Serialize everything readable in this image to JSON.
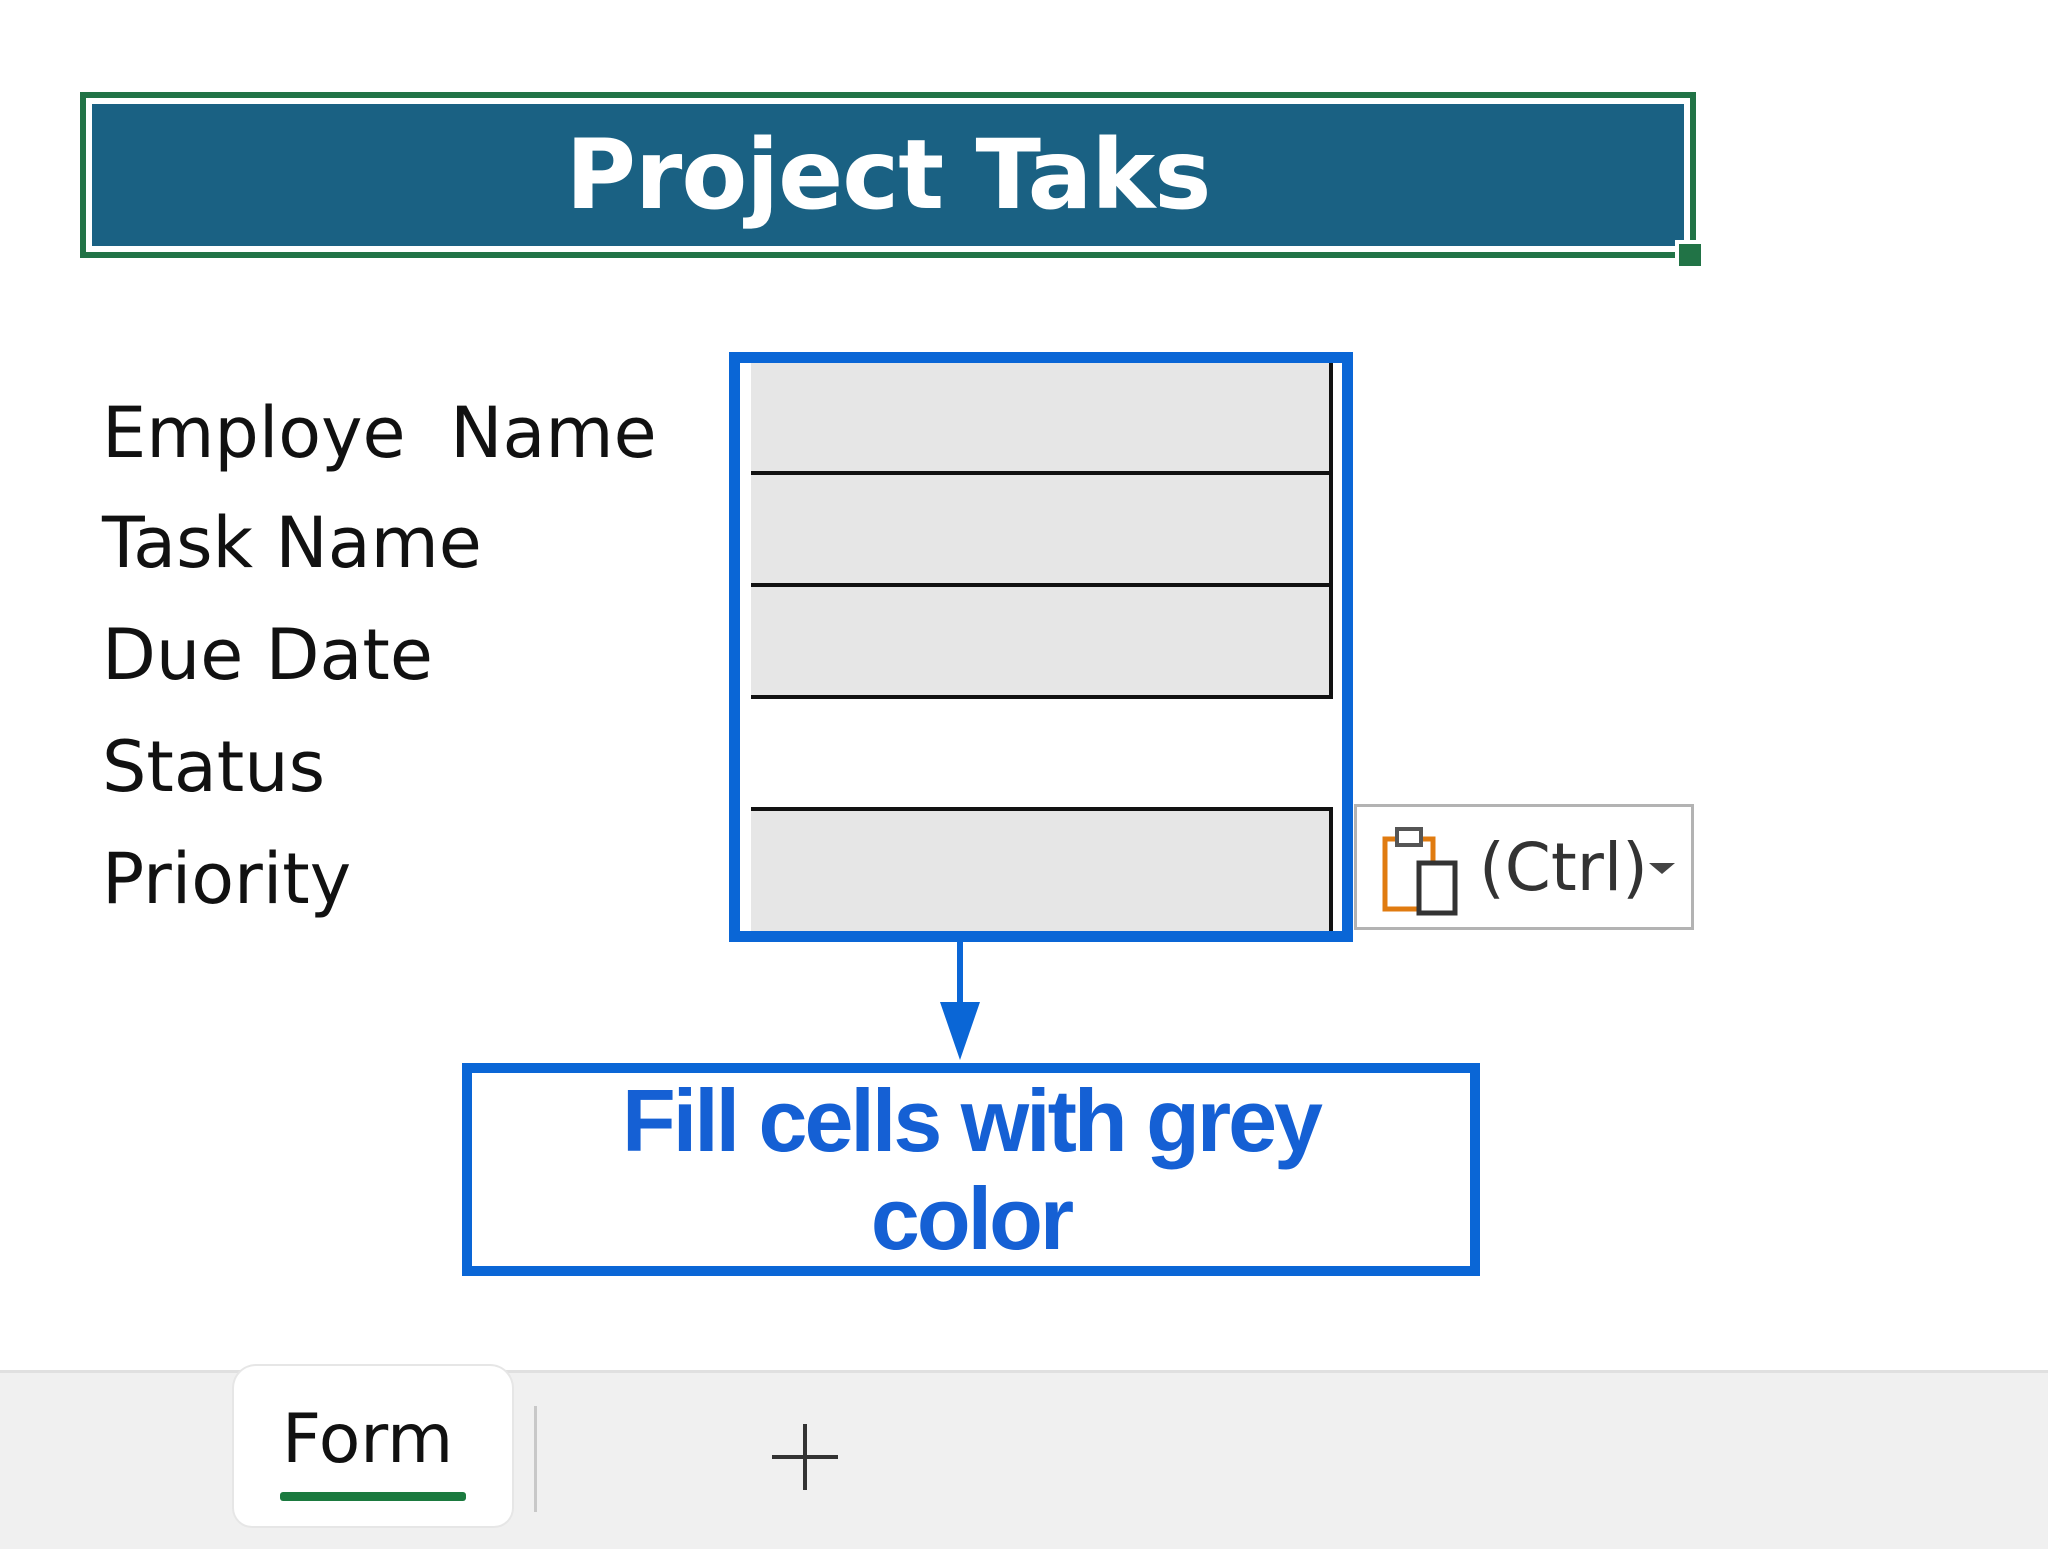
{
  "title": "Project Taks",
  "fields": [
    {
      "label": "Employe  Name",
      "fill": "grey"
    },
    {
      "label": "Task Name",
      "fill": "grey"
    },
    {
      "label": "Due Date",
      "fill": "grey"
    },
    {
      "label": "Status",
      "fill": "white"
    },
    {
      "label": "Priority",
      "fill": "grey"
    }
  ],
  "paste_options": {
    "label": "(Ctrl)",
    "icon": "clipboard-paste-icon"
  },
  "callout": {
    "text": "Fill cells with grey color"
  },
  "sheet_tabs": {
    "active": "Form",
    "add_icon": "plus-icon"
  },
  "colors": {
    "title_bg": "#1a6183",
    "selection_green": "#217346",
    "annotation_blue": "#0a66d6",
    "cell_grey": "#e6e6e6"
  }
}
